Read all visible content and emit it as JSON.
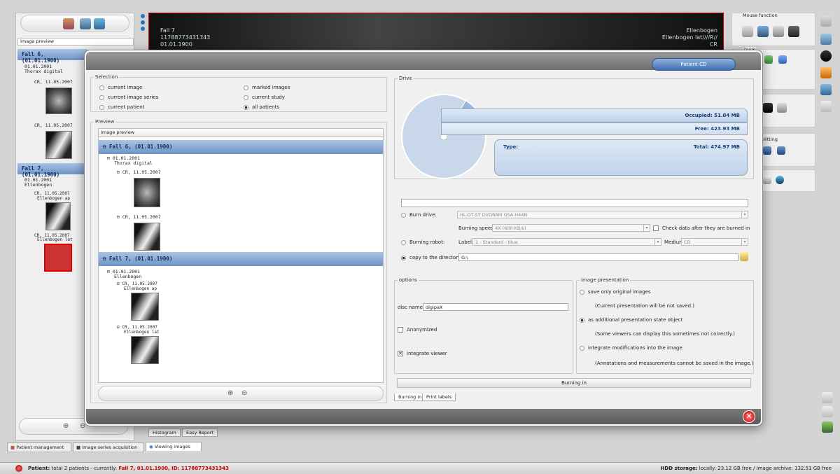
{
  "background": {
    "left_panel_header": "Image preview",
    "left_tree": [
      {
        "fall": "Fall 6,  (01.01.1900)",
        "study_date": "01.01.2001",
        "study_desc": "Thorax digital",
        "series": [
          {
            "label": "CR, 11.05.2007"
          },
          {
            "label": "CR, 11.05.2007"
          }
        ]
      },
      {
        "fall": "Fall 7,  (01.01.1900)",
        "study_date": "01.01.2001",
        "study_desc": "Ellenbogen",
        "series": [
          {
            "label": "CR, 11.05.2007",
            "sub": "Ellenbogen ap"
          },
          {
            "label": "CR, 11.05.2007",
            "sub": "Ellenbogen lat"
          }
        ]
      }
    ],
    "viewer_overlay": {
      "left_line1": "Fall 7",
      "left_line2": "11788773431343",
      "left_line3": "01.01.1900",
      "right_line1": "Ellenbogen",
      "right_line2": "Ellenbogen lat////R//",
      "right_line3": "CR"
    },
    "right_panel": {
      "mouse_function": "Mouse function",
      "zoom": "Zoom",
      "splitting": "plitting"
    },
    "bottom_tabs_mid": [
      "Histogram",
      "Easy Report"
    ],
    "bottom_tabs": [
      "Patient management",
      "Image series acquisition",
      "Viewing images"
    ]
  },
  "status": {
    "patient_label": "Patient:",
    "patient_text": "total 2 patients - currently:",
    "patient_current": "Fall 7, 01.01.1900, ID: 11788773431343",
    "hdd_label": "HDD storage:",
    "hdd_text": "locally: 23.12 GB free / Image archive: 132.51 GB free"
  },
  "dialog": {
    "title_button": "Patient CD",
    "selection": {
      "title": "Selection",
      "options": [
        {
          "label": "current image",
          "selected": false
        },
        {
          "label": "marked images",
          "selected": false
        },
        {
          "label": "current image series",
          "selected": false
        },
        {
          "label": "current study",
          "selected": false
        },
        {
          "label": "current patient",
          "selected": false
        },
        {
          "label": "all patients",
          "selected": true
        }
      ]
    },
    "preview": {
      "title": "Preview",
      "header": "Image preview",
      "fall6": "Fall 6,  (01.01.1900)",
      "fall6_date": "01.01.2001",
      "fall6_desc": "Thorax digital",
      "fall6_series1": "CR, 11.05.2007",
      "fall6_series2": "CR, 11.05.2007",
      "fall7": "Fall 7,  (01.01.1900)",
      "fall7_date": "01.01.2001",
      "fall7_desc": "Ellenbogen",
      "fall7_series1": "CR, 11.05.2007",
      "fall7_series1_sub": "Ellenbogen ap",
      "fall7_series2": "CR, 11.05.2007",
      "fall7_series2_sub": "Ellenbogen lat"
    },
    "drive": {
      "title": "Drive",
      "occupied": "Occupied: 51.04 MB",
      "free": "Free: 423.93 MB",
      "type_label": "Type:",
      "total": "Total: 474.97 MB",
      "occupied_fraction": 0.107
    },
    "burn": {
      "burn_drive_label": "Burn drive:",
      "burn_drive_value": "HL-DT-ST DVDRAM GSA-H44N",
      "burning_speed_label": "Burning speed:",
      "burning_speed_value": "4X (600 KB/s)",
      "check_data_label": "Check data after they are burned in",
      "burning_robot_label": "Burning robot:",
      "label_label": "Label:",
      "label_value": "1 - Standard - blue",
      "medium_label": "Medium:",
      "medium_value": "CD",
      "copy_label": "copy to the directory:",
      "copy_value": "G:\\"
    },
    "options": {
      "title": "options",
      "disc_name_label": "disc name:",
      "disc_name_value": "digipaX",
      "anonymized": "Anonymized",
      "integrate_viewer": "integrate viewer"
    },
    "presentation": {
      "title": "image presentation",
      "opt1": "save only original images",
      "opt1_note": "(Current presentation will be not saved.)",
      "opt2": "as additional presentation state object",
      "opt2_note": "(Some viewers can display this sometimes not correctly.)",
      "opt3": "integrate modifications into the image",
      "opt3_note": "(Annotations and measurements cannot be saved in the image.)"
    },
    "burning_in_button": "Burning in",
    "tabs": [
      "Burning in",
      "Print labels"
    ]
  }
}
